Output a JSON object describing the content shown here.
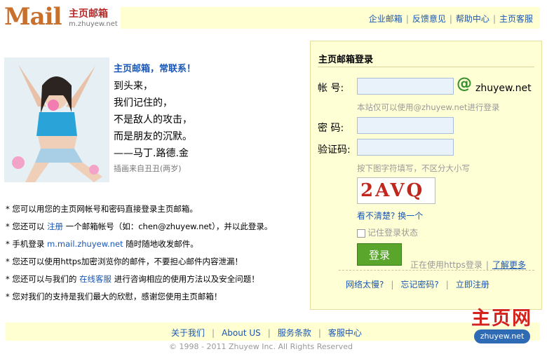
{
  "logo": {
    "mail": "Mail",
    "cn": "主页邮箱",
    "domain": "m.zhuyew.net"
  },
  "nav": [
    "企业邮箱",
    "反馈意见",
    "帮助中心",
    "主页客服"
  ],
  "quote": {
    "title": "主页邮箱，常联系！",
    "lines": [
      "到头来，",
      "我们记住的，",
      "不是敌人的攻击，",
      "而是朋友的沉默。",
      "——马丁.路德.金"
    ],
    "credit": "插画来自丑丑(两岁)"
  },
  "bullets": [
    {
      "pre": "* 您可以用您的主页网帐号和密码直接登录主页邮箱。",
      "link": "",
      "post": ""
    },
    {
      "pre": "* 您还可以 ",
      "link": "注册",
      "post": " 一个邮箱帐号（如：chen@zhuyew.net），并以此登录。"
    },
    {
      "pre": "* 手机登录 ",
      "link": "m.mail.zhuyew.net",
      "post": " 随时随地收发邮件。"
    },
    {
      "pre": "* 您还可以使用https加密浏览你的邮件，不要担心邮件内容泄漏！",
      "link": "",
      "post": ""
    },
    {
      "pre": "* 您还可以与我们的 ",
      "link": "在线客服",
      "post": " 进行咨询相应的使用方法以及安全问题！"
    },
    {
      "pre": "* 您对我们的支持是我们最大的欣慰，感谢您使用主页邮箱！",
      "link": "",
      "post": ""
    }
  ],
  "login": {
    "title": "主页邮箱登录",
    "account_label": "帐  号:",
    "at_symbol": "@",
    "domain": "zhuyew.net",
    "account_hint": "本站仅可以使用@zhuyew.net进行登录",
    "password_label": "密  码:",
    "captcha_label": "验证码:",
    "captcha_hint": "按下图字符填写，不区分大小写",
    "captcha_text": "2AVQ",
    "unclear": "看不清楚?",
    "refresh": "换一个",
    "remember": "记住登录状态",
    "button": "登录",
    "https_text": "正在使用https登录",
    "learn_more": "了解更多",
    "bottom_links": [
      "网络太慢?",
      "忘记密码?",
      "立即注册"
    ]
  },
  "footer": {
    "links": [
      "关于我们",
      "About US",
      "服务条款",
      "客服中心"
    ],
    "copyright": "© 1998 - 2011 Zhuyew Inc. All Rights Reserved"
  },
  "watermark": {
    "big": "主页网",
    "small": "zhuyew.net"
  },
  "colors": {
    "link": "#1a57b5",
    "header_bg": "#ffffd2",
    "logo": "#c8702c",
    "button": "#5aa62c"
  }
}
